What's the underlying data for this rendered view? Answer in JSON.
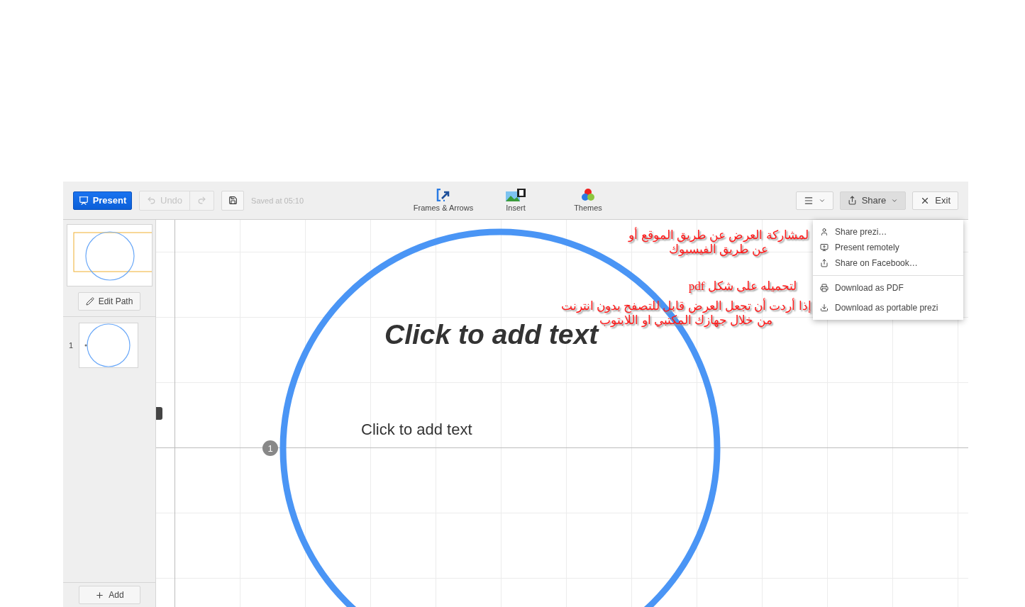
{
  "toolbar": {
    "present": "Present",
    "undo": {
      "label": "Undo",
      "disabled": true
    },
    "redo": {
      "disabled": true
    },
    "saved": "Saved at 05:10",
    "tools": [
      {
        "label": "Frames & Arrows",
        "kind": "frames"
      },
      {
        "label": "Insert",
        "kind": "insert"
      },
      {
        "label": "Themes",
        "kind": "themes"
      }
    ],
    "share": {
      "label": "Share",
      "expanded": true
    },
    "exit": "Exit"
  },
  "sidebar": {
    "edit_path": "Edit Path",
    "slides": [
      {
        "number": "1"
      }
    ],
    "add": "Add"
  },
  "canvas": {
    "title": "Click to add text",
    "body": "Click to add text",
    "path_badge": "1"
  },
  "share_menu": {
    "sections": [
      [
        {
          "label": "Share prezi…",
          "kind": "person"
        },
        {
          "label": "Present remotely",
          "kind": "remote"
        },
        {
          "label": "Share on Facebook…",
          "kind": "share"
        }
      ],
      [
        {
          "label": "Download as PDF",
          "kind": "print"
        },
        {
          "label": "Download as portable prezi",
          "kind": "download"
        }
      ]
    ]
  },
  "annotations": [
    {
      "text": "لمشاركة العرض عن طريق الموقع أو عن طريق الفيسبوك"
    },
    {
      "text": "لتحميله على شكل pdf"
    },
    {
      "text": "إذا أردت أن تجعل العرض قابل للتصفح بدون انترنت من خلال جهازك المكتبي او اللابتوب"
    }
  ]
}
